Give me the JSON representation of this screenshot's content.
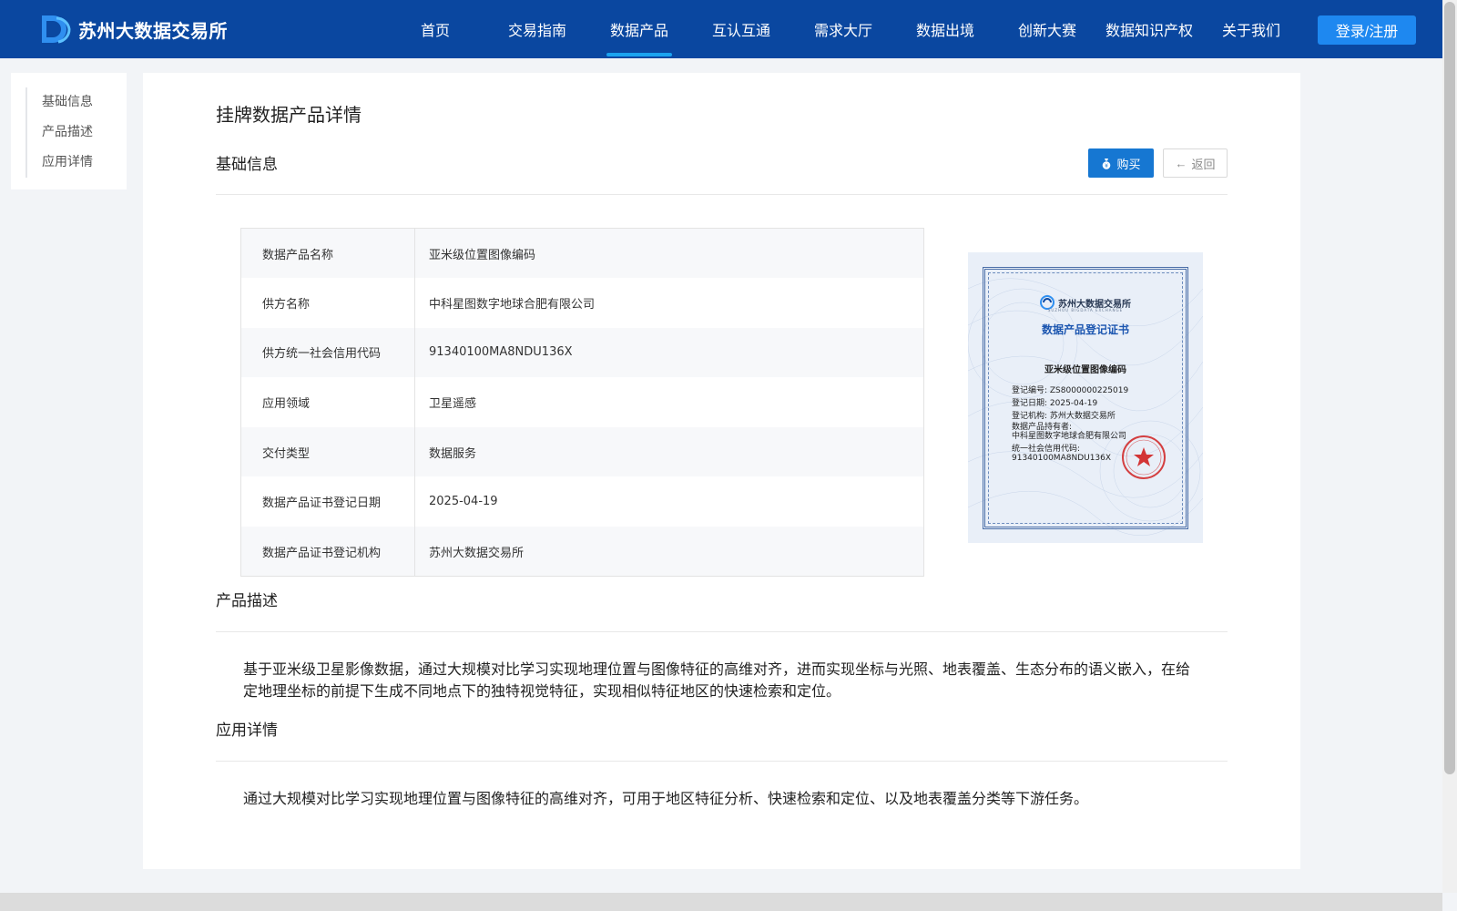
{
  "header": {
    "logo_text": "苏州大数据交易所",
    "nav": [
      "首页",
      "交易指南",
      "数据产品",
      "互认互通",
      "需求大厅",
      "数据出境",
      "创新大赛",
      "数据知识产权",
      "关于我们"
    ],
    "active_nav": "数据产品",
    "login_label": "登录/注册",
    "brand_color": "#0a47a0"
  },
  "side_nav": {
    "items": [
      "基础信息",
      "产品描述",
      "应用详情"
    ]
  },
  "main": {
    "page_title": "挂牌数据产品详情",
    "basic_section_title": "基础信息",
    "buy_label": "购买",
    "back_label": "返回",
    "info_rows": [
      {
        "key": "数据产品名称",
        "value": "亚米级位置图像编码"
      },
      {
        "key": "供方名称",
        "value": "中科星图数字地球合肥有限公司"
      },
      {
        "key": "供方统一社会信用代码",
        "value": "91340100MA8NDU136X"
      },
      {
        "key": "应用领域",
        "value": "卫星遥感"
      },
      {
        "key": "交付类型",
        "value": "数据服务"
      },
      {
        "key": "数据产品证书登记日期",
        "value": "2025-04-19"
      },
      {
        "key": "数据产品证书登记机构",
        "value": "苏州大数据交易所"
      }
    ],
    "certificate": {
      "org_name": "苏州大数据交易所",
      "org_sub": "SUZHOU BIGDATA EXCHANGE",
      "title": "数据产品登记证书",
      "product_name": "亚米级位置图像编码",
      "lines": [
        "登记编号: ZS8000000225019",
        "登记日期: 2025-04-19",
        "登记机构: 苏州大数据交易所",
        "数据产品持有者:",
        "中科星图数字地球合肥有限公司",
        "统一社会信用代码:",
        "91340100MA8NDU136X"
      ]
    },
    "desc_section_title": "产品描述",
    "desc_text": "基于亚米级卫星影像数据，通过大规模对比学习实现地理位置与图像特征的高维对齐，进而实现坐标与光照、地表覆盖、生态分布的语义嵌入，在给定地理坐标的前提下生成不同地点下的独特视觉特征，实现相似特征地区的快速检索和定位。",
    "app_section_title": "应用详情",
    "app_text": "通过大规模对比学习实现地理位置与图像特征的高维对齐，可用于地区特征分析、快速检索和定位、以及地表覆盖分类等下游任务。"
  }
}
